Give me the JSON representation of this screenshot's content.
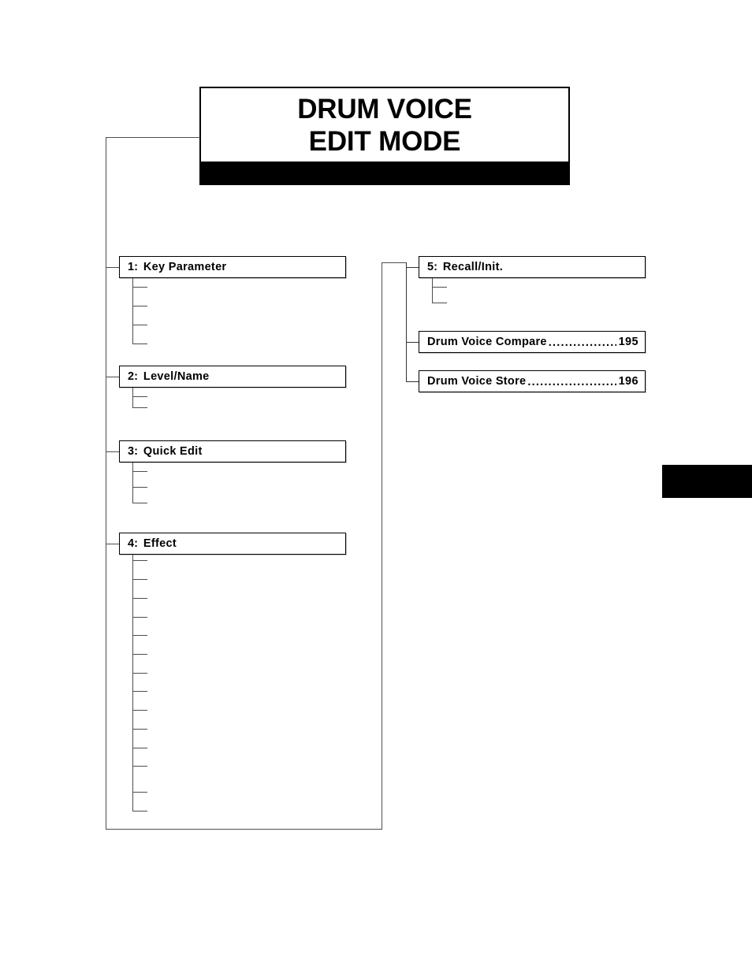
{
  "document": {
    "title_lines": [
      "DRUM VOICE",
      "EDIT MODE"
    ],
    "leader_dots_long": "...........................................",
    "leader_dots_short": "......................................."
  },
  "tree": {
    "left_column": [
      {
        "num": "1:",
        "label": "Key Parameter",
        "sub_count": 4
      },
      {
        "num": "2:",
        "label": "Level/Name",
        "sub_count": 2
      },
      {
        "num": "3:",
        "label": "Quick Edit",
        "sub_count": 3
      },
      {
        "num": "4:",
        "label": "Effect",
        "sub_count": 14
      }
    ],
    "right_column": [
      {
        "num": "5:",
        "label": "Recall/Init.",
        "sub_count": 2
      }
    ],
    "right_toc": [
      {
        "title": "Drum Voice Compare",
        "page": "195"
      },
      {
        "title": "Drum Voice Store",
        "page": "196"
      }
    ]
  },
  "edge_tab": {
    "color": "#000000"
  },
  "colors": {
    "line": "#4d4d4d",
    "box_border": "#000000",
    "box_shadow": "#c9c9c9",
    "text": "#000000",
    "background": "#ffffff"
  }
}
